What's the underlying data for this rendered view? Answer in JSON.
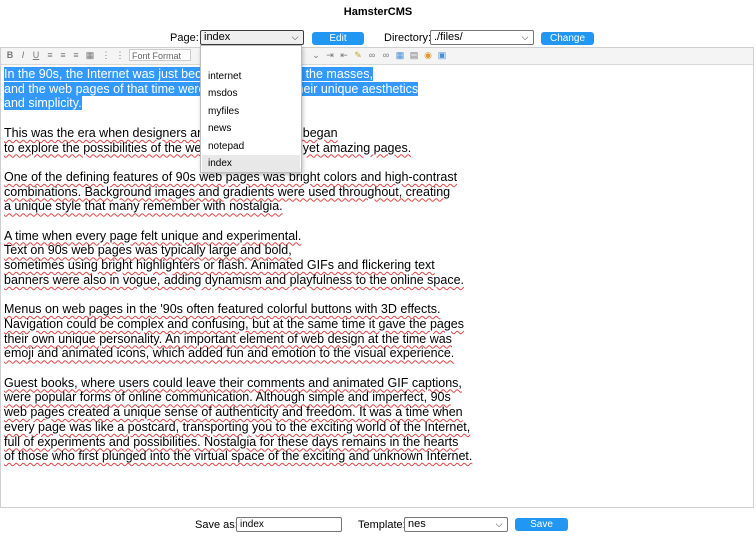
{
  "app": {
    "title": "HamsterCMS"
  },
  "top": {
    "page_label": "Page:",
    "page_value": "index",
    "edit_label": "Edit",
    "directory_label": "Directory:",
    "directory_value": "./files/",
    "change_label": "Change"
  },
  "toolbar": {
    "font_format": "Font Format",
    "icons": [
      "bold-icon",
      "italic-icon",
      "underline-icon",
      "align-left-icon",
      "align-center-icon",
      "align-right-icon",
      "justify-icon",
      "ordered-list-icon",
      "unordered-list-icon",
      "font-format-select",
      "indent-icon",
      "outdent-icon",
      "image-icon",
      "link-icon",
      "unlink-icon",
      "table-icon",
      "source-icon",
      "color-icon",
      "html-icon"
    ]
  },
  "dropdown": {
    "options": [
      "",
      "internet",
      "msdos",
      "myfiles",
      "news",
      "notepad",
      "index"
    ],
    "selected": "index"
  },
  "content": {
    "paragraphs": [
      [
        "In the 90s, the Internet was just becoming available to the masses,",
        "and the web pages of that time were remarkable for their unique aesthetics",
        "and simplicity."
      ],
      [
        "This was the era when designers and developers first began",
        "to explore the possibilities of the web, creating simple yet amazing pages."
      ],
      [
        "One of the defining features of 90s web pages was bright colors and high-contrast",
        "combinations. Background images and gradients were used throughout, creating",
        "a unique style that many remember with nostalgia."
      ],
      [
        "A time when every page felt unique and experimental.",
        "Text on 90s web pages was typically large and bold,",
        "sometimes using bright highlighters or flash. Animated GIFs and flickering text",
        "banners were also in vogue, adding dynamism and playfulness to the online space."
      ],
      [
        "Menus on web pages in the '90s often featured colorful buttons with 3D effects.",
        "Navigation could be complex and confusing, but at the same time it gave the pages",
        "their own unique personality. An important element of web design at the time was",
        "emoji and animated icons, which added fun and emotion to the visual experience."
      ],
      [
        "Guest books, where users could leave their comments and animated GIF captions,",
        "were popular forms of online communication. Although simple and imperfect, 90s",
        "web pages created a unique sense of authenticity and freedom. It was a time when",
        "every page was like a postcard, transporting you to the exciting world of the Internet,",
        "full of experiments and possibilities. Nostalgia for these days remains in the hearts",
        "of those who first plunged into the virtual space of the exciting and unknown Internet."
      ]
    ]
  },
  "bottom": {
    "save_as_label": "Save as:",
    "save_as_value": "index",
    "template_label": "Template:",
    "template_value": "nes",
    "save_label": "Save"
  },
  "colors": {
    "button": "#2196f3",
    "selection": "#3399ff",
    "spell_underline": "#e04545"
  }
}
